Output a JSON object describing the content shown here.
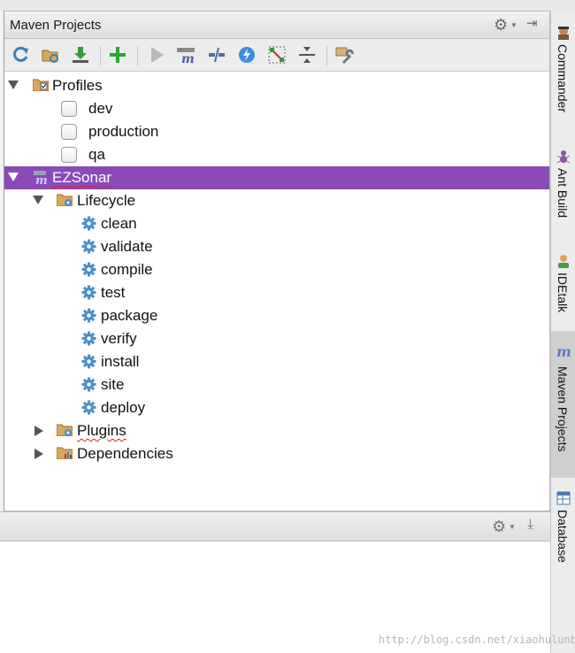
{
  "panel": {
    "title": "Maven Projects"
  },
  "toolbar": {
    "buttons": [
      {
        "name": "reimport-button",
        "icon": "refresh-icon"
      },
      {
        "name": "generate-sources-button",
        "icon": "folder-refresh-icon"
      },
      {
        "name": "download-sources-button",
        "icon": "download-icon"
      },
      {
        "name": "add-maven-project-button",
        "icon": "plus-icon"
      },
      {
        "name": "run-maven-build-button",
        "icon": "play-icon"
      },
      {
        "name": "execute-maven-goal-button",
        "icon": "maven-goal-icon"
      },
      {
        "name": "toggle-offline-button",
        "icon": "offline-icon"
      },
      {
        "name": "skip-tests-button",
        "icon": "lightning-icon"
      },
      {
        "name": "show-dependencies-button",
        "icon": "diagram-icon"
      },
      {
        "name": "collapse-all-button",
        "icon": "collapse-icon"
      },
      {
        "name": "maven-settings-button",
        "icon": "wrench-icon"
      }
    ]
  },
  "tree": {
    "profiles": {
      "label": "Profiles",
      "items": [
        "dev",
        "production",
        "qa"
      ]
    },
    "project": {
      "label": "EZSonar",
      "lifecycle": {
        "label": "Lifecycle",
        "goals": [
          "clean",
          "validate",
          "compile",
          "test",
          "package",
          "verify",
          "install",
          "site",
          "deploy"
        ]
      },
      "plugins": {
        "label": "Plugins"
      },
      "dependencies": {
        "label": "Dependencies"
      }
    }
  },
  "sidebar": {
    "tabs": [
      {
        "label": "Commander",
        "icon": "commander-icon",
        "active": false
      },
      {
        "label": "Ant Build",
        "icon": "ant-icon",
        "active": false
      },
      {
        "label": "IDEtalk",
        "icon": "idetalk-icon",
        "active": false
      },
      {
        "label": "Maven Projects",
        "icon": "maven-icon",
        "active": true
      },
      {
        "label": "Database",
        "icon": "database-icon",
        "active": false
      }
    ]
  },
  "watermark": "http://blog.csdn.net/xiaohulunb",
  "colors": {
    "selection": "#8a4bb8",
    "gear": "#4a90c8",
    "plus": "#2fa52f"
  }
}
